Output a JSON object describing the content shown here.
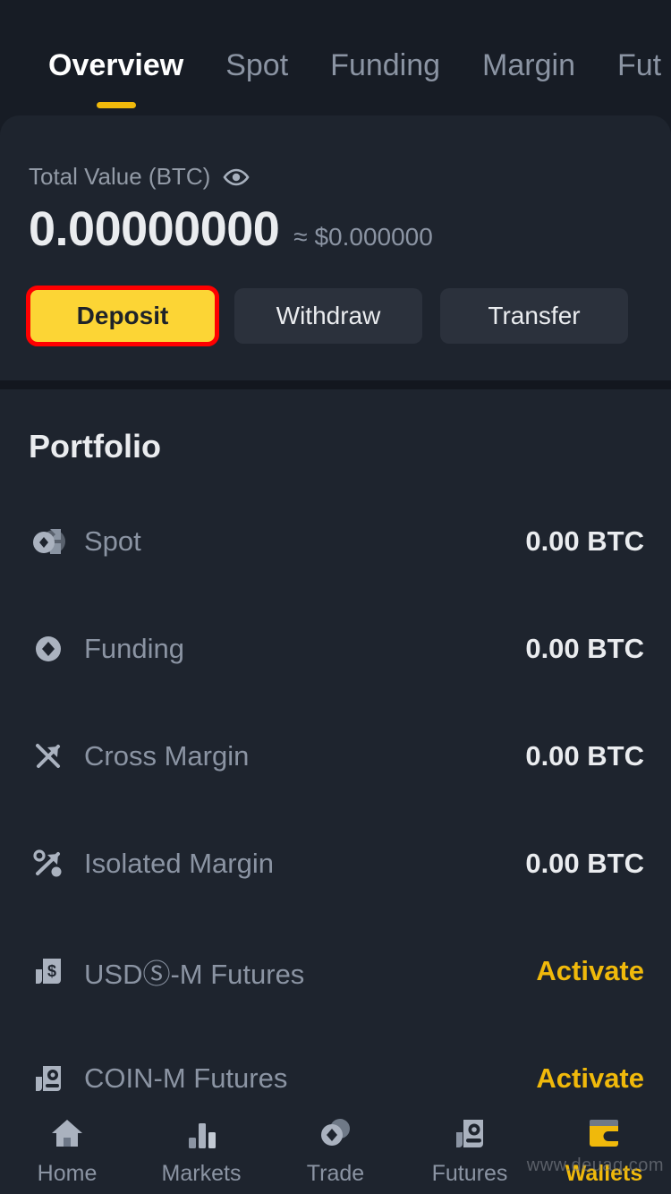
{
  "tabs": [
    {
      "label": "Overview",
      "active": true
    },
    {
      "label": "Spot",
      "active": false
    },
    {
      "label": "Funding",
      "active": false
    },
    {
      "label": "Margin",
      "active": false
    },
    {
      "label": "Fut",
      "active": false
    }
  ],
  "balance": {
    "label": "Total Value (BTC)",
    "visibility_icon": "eye-icon",
    "btc_value": "0.00000000",
    "usd_value": "≈ $0.000000"
  },
  "actions": {
    "deposit": "Deposit",
    "withdraw": "Withdraw",
    "transfer": "Transfer"
  },
  "portfolio": {
    "title": "Portfolio",
    "rows": [
      {
        "icon": "spot-icon",
        "name": "Spot",
        "value": "0.00 BTC",
        "is_activate": false
      },
      {
        "icon": "funding-icon",
        "name": "Funding",
        "value": "0.00 BTC",
        "is_activate": false
      },
      {
        "icon": "cross-margin-icon",
        "name": "Cross Margin",
        "value": "0.00 BTC",
        "is_activate": false
      },
      {
        "icon": "isolated-margin-icon",
        "name": "Isolated Margin",
        "value": "0.00 BTC",
        "is_activate": false
      },
      {
        "icon": "usds-futures-icon",
        "name": "USDⓈ-M Futures",
        "value": "Activate",
        "is_activate": true
      },
      {
        "icon": "coinm-futures-icon",
        "name": "COIN-M Futures",
        "value": "Activate",
        "is_activate": true
      }
    ]
  },
  "bottom_nav": [
    {
      "icon": "home-icon",
      "label": "Home",
      "active": false
    },
    {
      "icon": "markets-icon",
      "label": "Markets",
      "active": false
    },
    {
      "icon": "trade-icon",
      "label": "Trade",
      "active": false
    },
    {
      "icon": "futures-icon",
      "label": "Futures",
      "active": false
    },
    {
      "icon": "wallets-icon",
      "label": "Wallets",
      "active": true
    }
  ],
  "watermark": "www.deuaq.com",
  "colors": {
    "page_bg": "#171c25",
    "card_bg": "#1e242e",
    "accent_yellow": "#f0b90b",
    "primary_button": "#fcd535",
    "highlight_red": "#ff0000",
    "muted_text": "#8b94a3",
    "bright_text": "#eaecef"
  }
}
